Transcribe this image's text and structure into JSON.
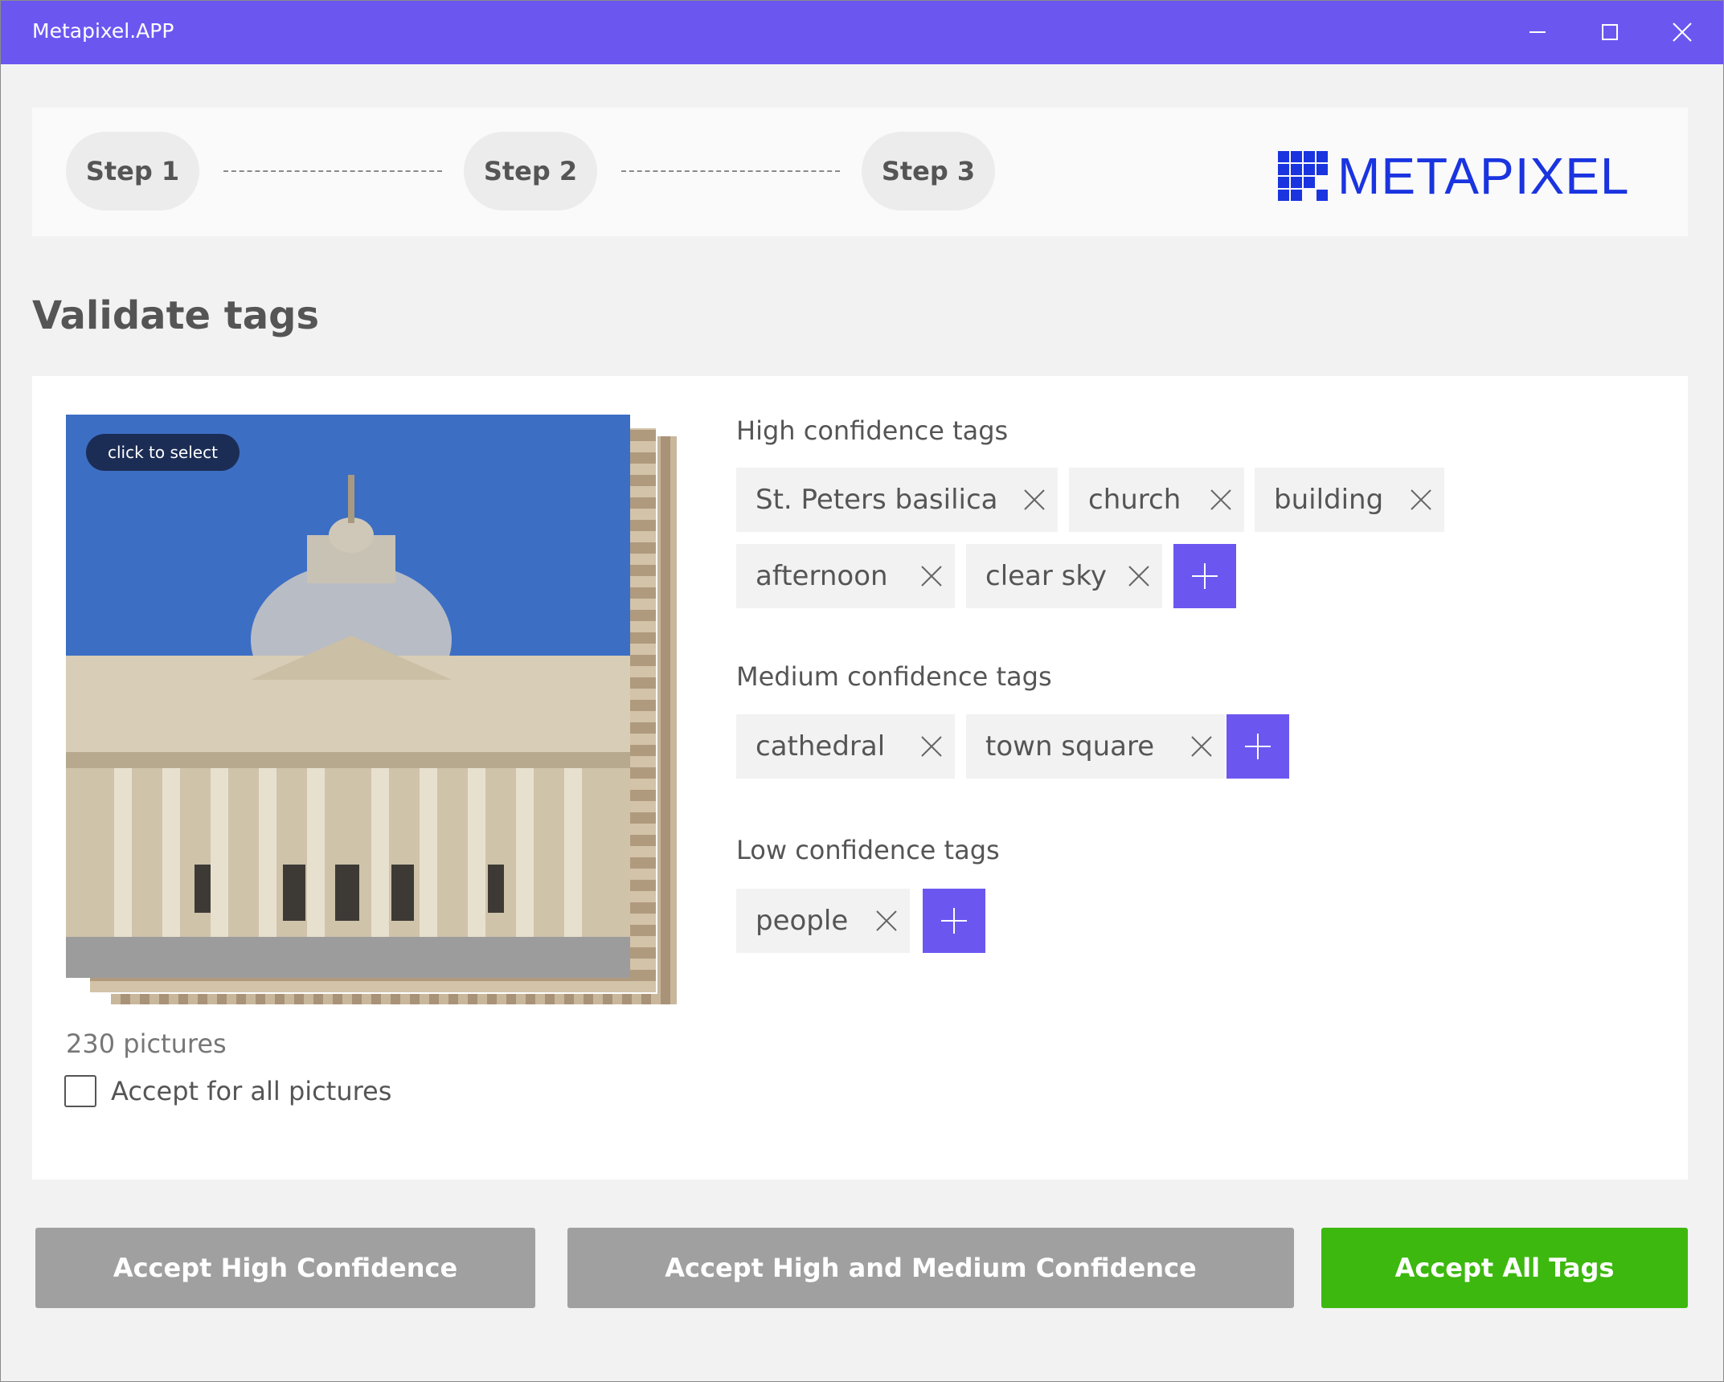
{
  "window": {
    "title": "Metapixel.APP"
  },
  "steps": [
    {
      "label": "Step 1"
    },
    {
      "label": "Step 2"
    },
    {
      "label": "Step 3"
    }
  ],
  "logo": {
    "text": "METAPIXEL",
    "color": "#1a34e0"
  },
  "page": {
    "title": "Validate tags"
  },
  "image": {
    "badge": "click to select",
    "count_label": "230 pictures",
    "accept_all_label": "Accept for all pictures",
    "accept_all_checked": false
  },
  "high": {
    "title": "High confidence tags",
    "tags": [
      "St. Peters basilica",
      "church",
      "building",
      "afternoon",
      "clear sky"
    ]
  },
  "medium": {
    "title": "Medium confidence tags",
    "tags": [
      "cathedral",
      "town square"
    ]
  },
  "low": {
    "title": "Low confidence tags",
    "tags": [
      "people"
    ]
  },
  "actions": {
    "accept_high": "Accept High Confidence",
    "accept_high_medium": "Accept High and Medium Confidence",
    "accept_all": "Accept All Tags"
  },
  "colors": {
    "accent": "#6b57f0",
    "accept_all": "#3db80f",
    "secondary_button": "#a0a0a0"
  }
}
